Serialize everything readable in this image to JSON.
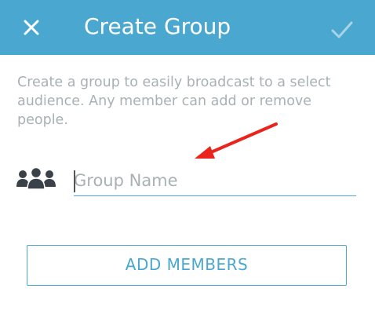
{
  "header": {
    "title": "Create Group",
    "close_icon": "close-icon",
    "confirm_icon": "checkmark-icon",
    "background_color": "#4aa7cf"
  },
  "description": "Create a group to easily broadcast to a select audience. Any member can add or remove people.",
  "group_name_field": {
    "placeholder": "Group Name",
    "value": "",
    "icon": "group-icon"
  },
  "add_members_button": {
    "label": "ADD MEMBERS"
  },
  "colors": {
    "accent": "#4aa7cf",
    "muted_text": "#a9b1b5",
    "annotation": "#e8241c"
  }
}
